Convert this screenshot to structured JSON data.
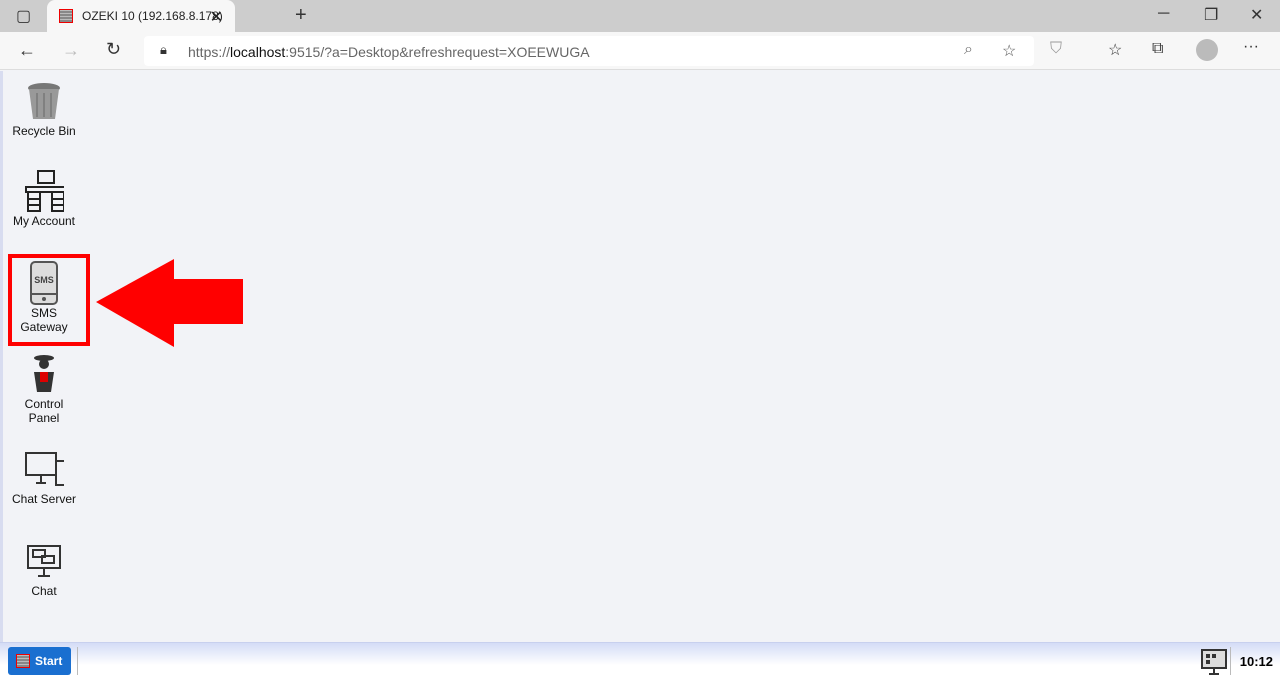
{
  "browser": {
    "tab_title": "OZEKI 10 (192.168.8.178)",
    "url_prefix": "https://",
    "url_host": "localhost",
    "url_rest": ":9515/?a=Desktop&refreshrequest=XOEEWUGA"
  },
  "desktop": {
    "icons": [
      {
        "label": "Recycle Bin"
      },
      {
        "label": "My Account"
      },
      {
        "label": "SMS Gateway",
        "glyph": "SMS",
        "highlighted": true
      },
      {
        "label": "Control Panel"
      },
      {
        "label": "Chat Server"
      },
      {
        "label": "Chat"
      }
    ]
  },
  "taskbar": {
    "start_label": "Start",
    "clock": "10:12"
  },
  "colors": {
    "highlight": "#ff0000",
    "start": "#1a6fd0"
  }
}
